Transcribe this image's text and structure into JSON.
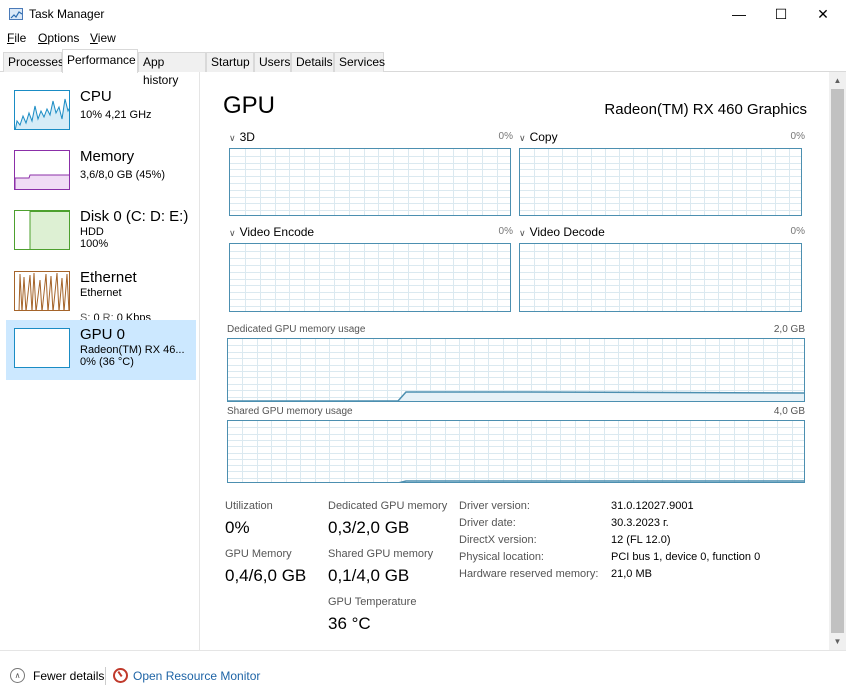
{
  "window": {
    "title": "Task Manager",
    "icon": "task-manager-icon"
  },
  "menu": [
    "File",
    "Options",
    "View"
  ],
  "tabs": [
    "Processes",
    "Performance",
    "App history",
    "Startup",
    "Users",
    "Details",
    "Services"
  ],
  "active_tab": "Performance",
  "sidebar": [
    {
      "title": "CPU",
      "line1": "10%  4,21 GHz",
      "line2": "",
      "color": "#1a8cc4"
    },
    {
      "title": "Memory",
      "line1": "3,6/8,0 GB (45%)",
      "line2": "",
      "color": "#8b2fa8"
    },
    {
      "title": "Disk 0 (C: D: E:)",
      "line1": "HDD",
      "line2": "100%",
      "color": "#4da02e"
    },
    {
      "title": "Ethernet",
      "line1": "Ethernet",
      "line2_label": "S:",
      "line2_value": "0",
      "line2_label2": "R:",
      "line2_value2": "0 Kbps",
      "color": "#a5642a"
    },
    {
      "title": "GPU 0",
      "line1": "Radeon(TM) RX 46...",
      "line2": "0%  (36 °C)",
      "color": "#1a8cc4",
      "selected": true
    }
  ],
  "main": {
    "title": "GPU",
    "model": "Radeon(TM) RX 460 Graphics",
    "engines": [
      {
        "name": "3D",
        "pct": "0%"
      },
      {
        "name": "Copy",
        "pct": "0%"
      },
      {
        "name": "Video Encode",
        "pct": "0%"
      },
      {
        "name": "Video Decode",
        "pct": "0%"
      }
    ],
    "dedicated_label": "Dedicated GPU memory usage",
    "dedicated_max": "2,0 GB",
    "shared_label": "Shared GPU memory usage",
    "shared_max": "4,0 GB",
    "stats": {
      "utilization_label": "Utilization",
      "utilization": "0%",
      "dedicated_label": "Dedicated GPU memory",
      "dedicated": "0,3/2,0 GB",
      "gpu_memory_label": "GPU Memory",
      "gpu_memory": "0,4/6,0 GB",
      "shared_label": "Shared GPU memory",
      "shared": "0,1/4,0 GB",
      "temp_label": "GPU Temperature",
      "temp": "36 °C"
    },
    "info": [
      {
        "key": "Driver version:",
        "value": "31.0.12027.9001"
      },
      {
        "key": "Driver date:",
        "value": "30.3.2023 г."
      },
      {
        "key": "DirectX version:",
        "value": "12 (FL 12.0)"
      },
      {
        "key": "Physical location:",
        "value": "PCI bus 1, device 0, function 0"
      },
      {
        "key": "Hardware reserved memory:",
        "value": "21,0 MB"
      }
    ]
  },
  "footer": {
    "fewer_details": "Fewer details",
    "open_monitor": "Open Resource Monitor"
  },
  "graph_color": "#4c8fb0"
}
